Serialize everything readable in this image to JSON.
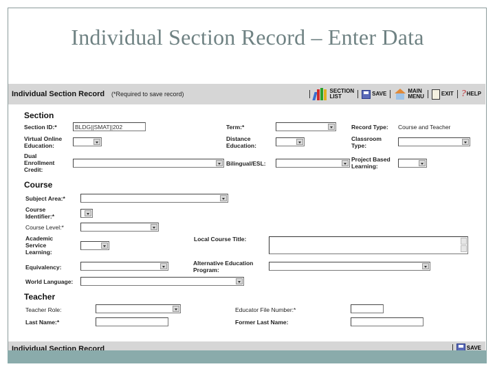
{
  "slide": {
    "title": "Individual Section Record – Enter Data"
  },
  "header": {
    "title": "Individual Section Record",
    "note": "(*Required to save record)",
    "toolbar": [
      {
        "id": "section-list",
        "icon": "books-icon",
        "label_line1": "SECTION",
        "label_line2": "LIST"
      },
      {
        "id": "save",
        "icon": "floppy-disk-icon",
        "label_line1": "SAVE",
        "label_line2": ""
      },
      {
        "id": "main-menu",
        "icon": "house-icon",
        "label_line1": "MAIN",
        "label_line2": "MENU"
      },
      {
        "id": "exit",
        "icon": "door-exit-icon",
        "label_line1": "EXIT",
        "label_line2": ""
      },
      {
        "id": "help",
        "icon": "question-mark-icon",
        "label_line1": "HELP",
        "label_line2": ""
      }
    ]
  },
  "section": {
    "heading": "Section",
    "section_id_label": "Section ID:*",
    "section_id_value": "BLDG||SMAT||202",
    "term_label": "Term:*",
    "term_value": "",
    "record_type_label": "Record Type:",
    "record_type_value": "Course and Teacher",
    "virtual_online_label": "Virtual Online Education:",
    "virtual_online_value": "",
    "distance_label": "Distance Education:",
    "distance_value": "",
    "classroom_type_label": "Classroom Type:",
    "classroom_type_value": "",
    "dual_enrollment_label": "Dual Enrollment Credit:",
    "dual_enrollment_value": "",
    "bilingual_label": "Bilingual/ESL:",
    "bilingual_value": "",
    "project_based_label": "Project Based Learning:",
    "project_based_value": ""
  },
  "course": {
    "heading": "Course",
    "subject_area_label": "Subject Area:*",
    "subject_area_value": "",
    "course_identifier_label": "Course Identifier:*",
    "course_identifier_value": "",
    "course_level_label": "Course Level:*",
    "course_level_value": "",
    "academic_service_label": "Academic Service Learning:",
    "academic_service_value": "",
    "local_course_title_label": "Local Course Title:",
    "local_course_title_value": "",
    "equivalency_label": "Equivalency:",
    "equivalency_value": "",
    "alt_education_label": "Alternative Education Program:",
    "alt_education_value": "",
    "world_language_label": "World Language:",
    "world_language_value": ""
  },
  "teacher": {
    "heading": "Teacher",
    "teacher_role_label": "Teacher Role:",
    "teacher_role_value": "",
    "educator_file_label": "Educator File Number:*",
    "educator_file_value": "",
    "last_name_label": "Last Name:*",
    "last_name_value": "",
    "former_last_name_label": "Former Last Name:",
    "former_last_name_value": ""
  },
  "footer": {
    "title": "Individual Section Record",
    "save_label": "SAVE"
  }
}
